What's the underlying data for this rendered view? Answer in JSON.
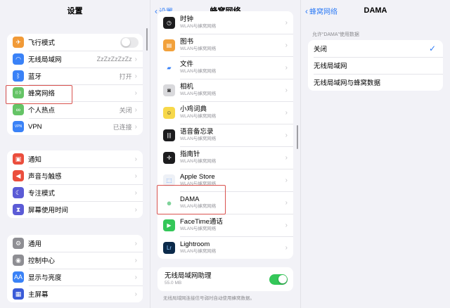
{
  "panel1": {
    "title": "设置",
    "group1": [
      {
        "label": "飞行模式",
        "value": "",
        "icon": "airplane-icon",
        "color": "#f19a37",
        "glyph": "✈",
        "toggle": "off"
      },
      {
        "label": "无线局域网",
        "value": "ZzZzZzZzZz",
        "icon": "wifi-icon",
        "color": "#3a82f7",
        "glyph": "◠"
      },
      {
        "label": "蓝牙",
        "value": "打开",
        "icon": "bluetooth-icon",
        "color": "#3a82f7",
        "glyph": "ᛒ"
      },
      {
        "label": "蜂窝网络",
        "value": "",
        "icon": "cellular-icon",
        "color": "#65c466",
        "glyph": "((·))"
      },
      {
        "label": "个人热点",
        "value": "关闭",
        "icon": "hotspot-icon",
        "color": "#65c466",
        "glyph": "∞"
      },
      {
        "label": "VPN",
        "value": "已连接",
        "icon": "vpn-icon",
        "color": "#3a82f7",
        "glyph": "VPN"
      }
    ],
    "group2": [
      {
        "label": "通知",
        "icon": "notification-icon",
        "color": "#eb4e3d",
        "glyph": "▣"
      },
      {
        "label": "声音与触感",
        "icon": "sound-icon",
        "color": "#eb4e3d",
        "glyph": "◀"
      },
      {
        "label": "专注模式",
        "icon": "moon-icon",
        "color": "#5b5bd6",
        "glyph": "☾"
      },
      {
        "label": "屏幕使用时间",
        "icon": "hourglass-icon",
        "color": "#5b5bd6",
        "glyph": "⧗"
      }
    ],
    "group3": [
      {
        "label": "通用",
        "icon": "gear-icon",
        "color": "#8e8e93",
        "glyph": "⚙"
      },
      {
        "label": "控制中心",
        "icon": "control-center-icon",
        "color": "#8e8e93",
        "glyph": "◉"
      },
      {
        "label": "显示与亮度",
        "icon": "display-icon",
        "color": "#3a82f7",
        "glyph": "AA"
      },
      {
        "label": "主屏幕",
        "icon": "home-screen-icon",
        "color": "#3a5bd8",
        "glyph": "▦"
      }
    ]
  },
  "panel2": {
    "back": "设置",
    "title": "蜂窝网络",
    "apps": [
      {
        "name": "时钟",
        "sub": "WLAN与蜂窝网络",
        "icon": "clock-icon",
        "color": "#1c1c1e",
        "glyph": "◷"
      },
      {
        "name": "图书",
        "sub": "WLAN与蜂窝网络",
        "icon": "books-icon",
        "color": "#f2a13b",
        "glyph": "▤"
      },
      {
        "name": "文件",
        "sub": "WLAN与蜂窝网络",
        "icon": "folder-icon",
        "color": "#ffffff",
        "glyph": "▰",
        "fg": "#3a82f7"
      },
      {
        "name": "相机",
        "sub": "WLAN与蜂窝网络",
        "icon": "camera-icon",
        "color": "#d9d9dc",
        "glyph": "◙",
        "fg": "#333"
      },
      {
        "name": "小鸡词典",
        "sub": "WLAN与蜂窝网络",
        "icon": "chick-icon",
        "color": "#f7d84a",
        "glyph": "☺",
        "fg": "#333"
      },
      {
        "name": "语音备忘录",
        "sub": "WLAN与蜂窝网络",
        "icon": "voice-memo-icon",
        "color": "#1c1c1e",
        "glyph": "|||"
      },
      {
        "name": "指南针",
        "sub": "WLAN与蜂窝网络",
        "icon": "compass-icon",
        "color": "#1c1c1e",
        "glyph": "✛"
      },
      {
        "name": "Apple Store",
        "sub": "WLAN与蜂窝网络",
        "icon": "apple-store-icon",
        "color": "#eef1f6",
        "glyph": "⬚",
        "fg": "#3a82f7"
      },
      {
        "name": "DAMA",
        "sub": "WLAN与蜂窝网络",
        "icon": "dama-app-icon",
        "color": "#ffffff",
        "glyph": "●",
        "fg": "#7fd39a"
      },
      {
        "name": "FaceTime通话",
        "sub": "WLAN与蜂窝网络",
        "icon": "facetime-icon",
        "color": "#34c759",
        "glyph": "▶"
      },
      {
        "name": "Lightroom",
        "sub": "WLAN与蜂窝网络",
        "icon": "lightroom-icon",
        "color": "#0b2a4a",
        "glyph": "Lr",
        "fg": "#8fc8ff"
      }
    ],
    "assist": {
      "label": "无线局域网助理",
      "size": "55.0 MB",
      "toggle": "on"
    },
    "footnote": "无线局域网连接信号弱时自动使用蜂窝数据。"
  },
  "panel3": {
    "back": "蜂窝网络",
    "title": "DAMA",
    "section": "允许“DAMA”使用数据",
    "options": [
      "关闭",
      "无线局域网",
      "无线局域网与蜂窝数据"
    ],
    "selected_index": 0
  },
  "colors": {
    "accent": "#2f7cf6",
    "highlight": "#d9534f",
    "toggle_on": "#34c759"
  }
}
